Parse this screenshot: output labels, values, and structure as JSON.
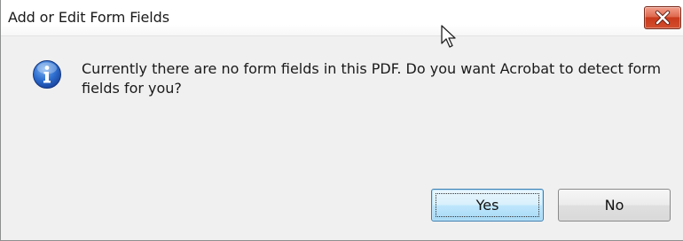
{
  "window": {
    "title": "Add or Edit Form Fields"
  },
  "message": {
    "text": "Currently there are no form fields in this PDF. Do you want Acrobat to detect form fields for you?"
  },
  "buttons": {
    "yes_label": "Yes",
    "no_label": "No"
  },
  "icons": {
    "info": "info-icon",
    "close": "close-icon",
    "cursor": "mouse-cursor-icon"
  },
  "colors": {
    "close_button": "#c9391b",
    "info_icon": "#1f5fbf",
    "dialog_background": "#f0f0f0"
  }
}
